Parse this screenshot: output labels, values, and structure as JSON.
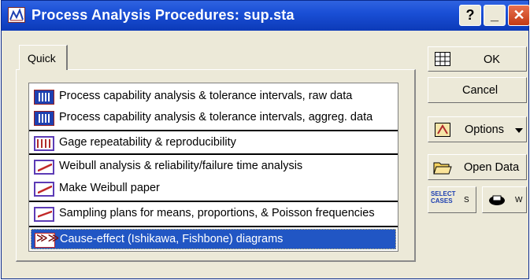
{
  "window": {
    "title": "Process Analysis Procedures: sup.sta",
    "help_label": "?",
    "minimize_label": "_",
    "close_label": "✕"
  },
  "tabs": [
    {
      "label": "Quick"
    }
  ],
  "procedures": [
    {
      "label": "Process capability analysis & tolerance intervals, raw data",
      "icon": "process-capability-icon",
      "selected": false
    },
    {
      "label": "Process capability analysis & tolerance intervals, aggreg. data",
      "icon": "process-capability-icon",
      "selected": false
    },
    {
      "label": "Gage repeatability & reproducibility",
      "icon": "gage-icon",
      "selected": false
    },
    {
      "label": "Weibull analysis & reliability/failure time analysis",
      "icon": "weibull-icon",
      "selected": false
    },
    {
      "label": "Make Weibull paper",
      "icon": "weibull-icon",
      "selected": false
    },
    {
      "label": "Sampling plans for means, proportions, & Poisson frequencies",
      "icon": "sampling-plan-icon",
      "selected": false
    },
    {
      "label": "Cause-effect (Ishikawa, Fishbone) diagrams",
      "icon": "cause-effect-icon",
      "selected": true
    }
  ],
  "buttons": {
    "ok": "OK",
    "cancel": "Cancel",
    "options": "Options",
    "open_data": "Open Data",
    "select_cases_icon_text": "SELECT CASES",
    "select_cases_key": "S",
    "weight_key": "W"
  },
  "colors": {
    "titlebar": "#1a4fd6",
    "selection": "#2156c4",
    "dialog_bg": "#ece9d8"
  }
}
